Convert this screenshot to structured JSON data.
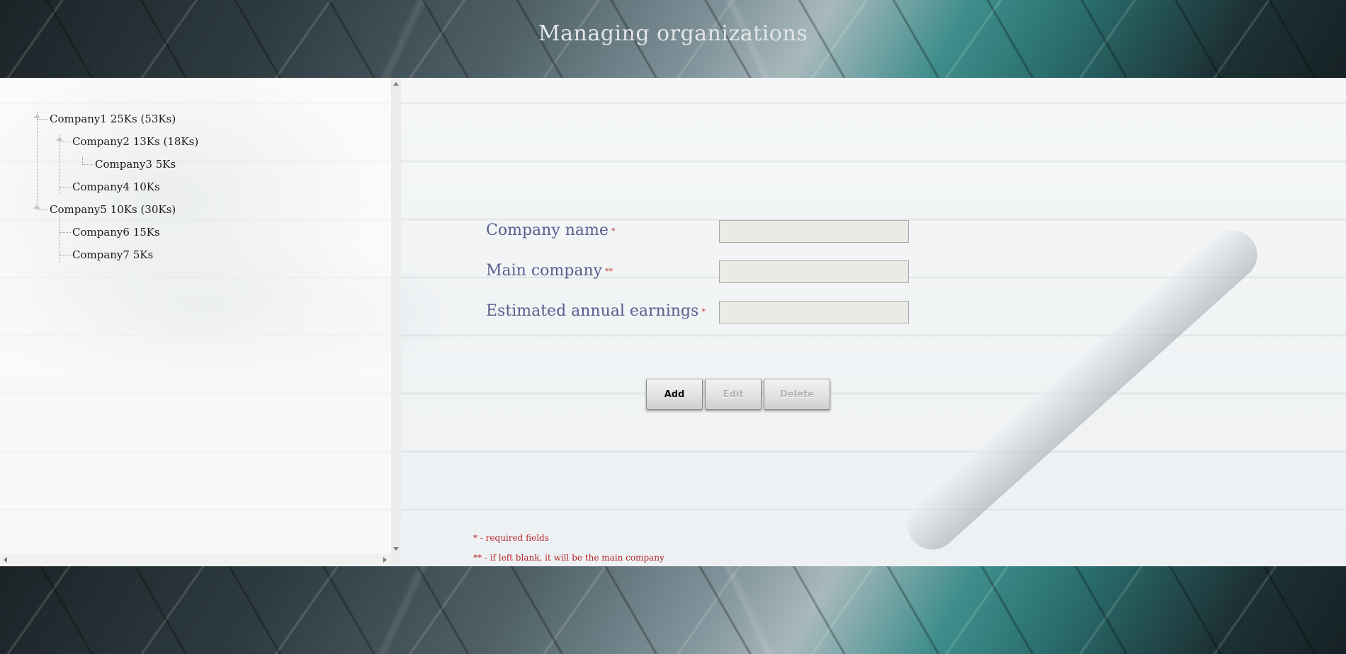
{
  "header": {
    "title": "Managing organizations"
  },
  "tree": {
    "nodes": [
      {
        "label": "Company1 25Ks (53Ks)",
        "level": 0,
        "expandable": true
      },
      {
        "label": "Company2 13Ks (18Ks)",
        "level": 1,
        "expandable": true
      },
      {
        "label": "Company3 5Ks",
        "level": 2,
        "expandable": false
      },
      {
        "label": "Company4 10Ks",
        "level": 1,
        "expandable": false
      },
      {
        "label": "Company5 10Ks (30Ks)",
        "level": 0,
        "expandable": true
      },
      {
        "label": "Company6 15Ks",
        "level": 1,
        "expandable": false
      },
      {
        "label": "Company7 5Ks",
        "level": 1,
        "expandable": false
      }
    ]
  },
  "form": {
    "company_name_label": "Company name",
    "company_name_marker": "*",
    "company_name_value": "",
    "main_company_label": "Main company",
    "main_company_marker": "**",
    "main_company_value": "",
    "earnings_label": "Estimated annual earnings",
    "earnings_marker": "*",
    "earnings_value": ""
  },
  "buttons": {
    "add": "Add",
    "edit": "Edit",
    "delete": "Delete"
  },
  "notes": {
    "required": "* - required fields",
    "main_company": "** - if left blank, it will be the main company"
  },
  "colors": {
    "label": "#5b5d8e",
    "required_marker": "#c0392b",
    "note": "#b3262a"
  }
}
